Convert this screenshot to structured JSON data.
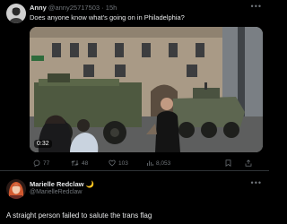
{
  "post": {
    "display_name": "Anny",
    "handle": "@anny25717503",
    "separator": "·",
    "time": "15h",
    "text": "Does anyone know what's going on in Philadelphia?",
    "video": {
      "duration": "0:32",
      "icon": "play-video"
    },
    "actions": {
      "replies": "77",
      "reposts": "48",
      "likes": "103",
      "views": "8,053"
    },
    "more_icon": "more-horizontal-icon"
  },
  "reply": {
    "display_name": "Marielle Redclaw",
    "emoji": "🌙",
    "handle": "@MarielleRedclaw",
    "text": "A straight person failed to salute the trans flag",
    "more_icon": "more-horizontal-icon"
  },
  "colors": {
    "background": "#000000",
    "text": "#e7e9ea",
    "muted": "#71767b",
    "divider": "#2f3336"
  }
}
